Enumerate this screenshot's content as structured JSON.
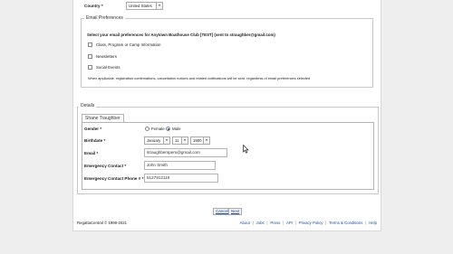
{
  "country": {
    "label": "Country *",
    "value": "United States"
  },
  "email_prefs": {
    "legend": "Email Preferences",
    "instruction": "Select your email preferences for Anytown Boathouse Club [TEST] (sent to straughber@gmail.com)",
    "options": [
      "Class, Program or Camp Information",
      "Newsletters",
      "Social Events"
    ],
    "note": "When applicable, registration confirmations, cancellation notices and related notifications will be sent, regardless of email preferences selected"
  },
  "details": {
    "legend": "Details",
    "tab": "Shane Traughber",
    "gender": {
      "label": "Gender *",
      "options": [
        "Female",
        "Male"
      ],
      "selected": "Male"
    },
    "birthdate": {
      "label": "Birthdate *",
      "month": "January",
      "day": "11",
      "year": "1900"
    },
    "email": {
      "label": "Email *",
      "value": "straughberspem@gmail.com"
    },
    "emergency_contact": {
      "label": "Emergency Contact *",
      "value": "John Smith"
    },
    "emergency_phone": {
      "label": "Emergency Contact Phone # *",
      "value": "5127912119"
    }
  },
  "actions": {
    "cancel": "Cancel",
    "next": "Next"
  },
  "footer": {
    "copyright": "RegattaCentral © 1999-2021",
    "links": [
      "About",
      "Jobs",
      "Press",
      "API",
      "Privacy Policy",
      "Terms & Conditions",
      "Help"
    ],
    "separator": "|"
  },
  "icons": {
    "dropdown": "chevron-down-icon",
    "cursor": "mouse-pointer-icon"
  }
}
